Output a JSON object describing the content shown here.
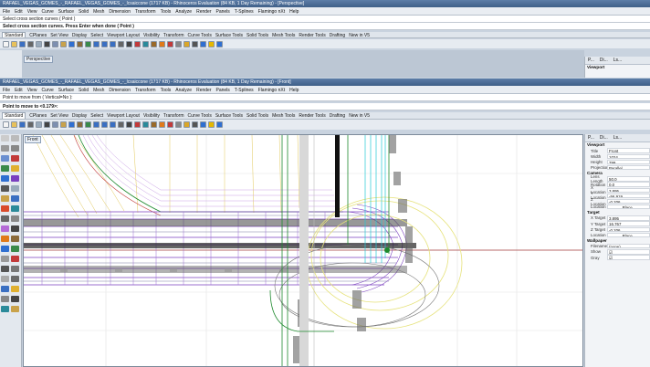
{
  "window_top": {
    "title": "RAFAEL_VEGAS_GOMES_-_RAFAEL_VEGAS_GOMES_-_lcsaiccone (1717 KB) - Rhinoceros Evaluation (84 KB, 1 Day Remaining) - [Perspective]",
    "menu": [
      "File",
      "Edit",
      "View",
      "Curve",
      "Surface",
      "Solid",
      "Mesh",
      "Dimension",
      "Transform",
      "Tools",
      "Analyze",
      "Render",
      "Panels",
      "T-Splines",
      "Flamingo nXt",
      "Help"
    ],
    "cmd_history": "Select cross section curves ( Point )",
    "cmd_prompt": "Select cross section curves. Press Enter when done ( Point )",
    "viewport_label": "Perspective"
  },
  "window_main": {
    "title": "RAFAEL_VEGAS_GOMES_-_RAFAEL_VEGAS_GOMES_-_lcsaiccone (1717 KB) - Rhinoceros Evaluation (84 KB, 1 Day Remaining) - [Front]",
    "menu": [
      "File",
      "Edit",
      "View",
      "Curve",
      "Surface",
      "Solid",
      "Mesh",
      "Dimension",
      "Transform",
      "Tools",
      "Analyze",
      "Render",
      "Panels",
      "T-Splines",
      "Flamingo nXt",
      "Help"
    ],
    "cmd_history": "Point to move from ( Vertical=No ):",
    "cmd_prompt": "Point to move to <0.179>:",
    "tabs": [
      "Standard",
      "CPlanes",
      "Set View",
      "Display",
      "Select",
      "Viewport Layout",
      "Visibility",
      "Transform",
      "Curve Tools",
      "Surface Tools",
      "Solid Tools",
      "Mesh Tools",
      "Render Tools",
      "Drafting",
      "New in V5"
    ],
    "viewport_label": "Front"
  },
  "panel": {
    "tabs": [
      "P...",
      "Di...",
      "Ls..."
    ],
    "viewport_section": "Viewport",
    "viewport_props": [
      {
        "k": "Title",
        "v": "Front"
      },
      {
        "k": "Width",
        "v": "1024"
      },
      {
        "k": "Height",
        "v": "799"
      },
      {
        "k": "Projection",
        "v": "Parallel"
      }
    ],
    "camera_section": "Camera",
    "camera_props": [
      {
        "k": "Lens Length",
        "v": "50.0"
      },
      {
        "k": "Rotation",
        "v": "0.0"
      },
      {
        "k": "X Location",
        "v": "3.895"
      },
      {
        "k": "Y Location",
        "v": "-56.919"
      },
      {
        "k": "Z Location",
        "v": "-0.206"
      }
    ],
    "location_btn": "Place...",
    "target_section": "Target",
    "target_props": [
      {
        "k": "X Target",
        "v": "3.895"
      },
      {
        "k": "Y Target",
        "v": "16.767"
      },
      {
        "k": "Z Target",
        "v": "-0.206"
      }
    ],
    "target_location_btn": "Place...",
    "location_label": "Location",
    "wallpaper_section": "Wallpaper",
    "wallpaper_props": [
      {
        "k": "Filename",
        "v": "(none)"
      },
      {
        "k": "Show",
        "v": "☑"
      },
      {
        "k": "Gray",
        "v": "☑"
      }
    ]
  },
  "colors": {
    "title": "#4a6c96",
    "curve_purple": "#7a3fbf",
    "curve_yellow": "#e6e27a",
    "curve_cyan": "#22c9d6",
    "curve_green": "#1e8a2e"
  }
}
